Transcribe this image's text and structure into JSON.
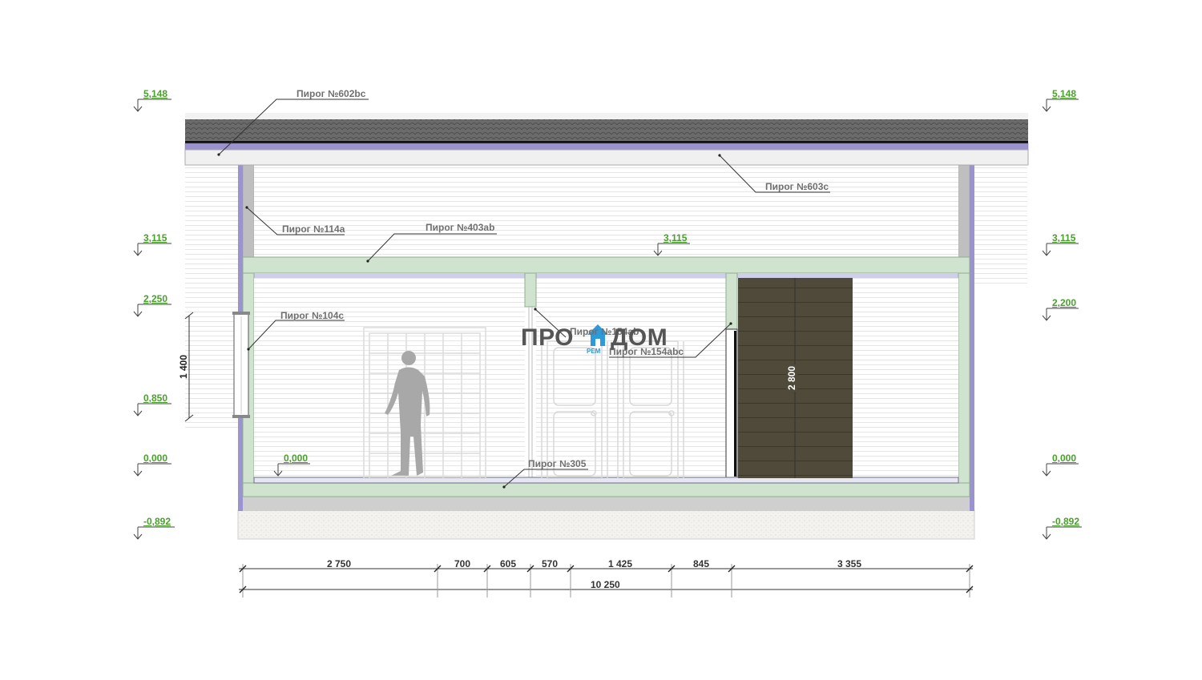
{
  "levels": {
    "left": [
      "5,148",
      "3,115",
      "2,250",
      "0,850",
      "0,000",
      "-0,892"
    ],
    "right": [
      "5,148",
      "3,115",
      "2,200",
      "0,000",
      "-0,892"
    ],
    "inner_ceiling": "3,115",
    "inner_floor": "0,000"
  },
  "labels": {
    "pirog_602bc": "Пирог №602bc",
    "pirog_603c": "Пирог №603c",
    "pirog_114a": "Пирог №114a",
    "pirog_403ab": "Пирог №403ab",
    "pirog_104c": "Пирог №104c",
    "pirog_154ab": "Пирог №154ab",
    "pirog_154abc": "Пирог №154abc",
    "pirog_305": "Пирог №305"
  },
  "dimensions": {
    "segments": [
      "2 750",
      "700",
      "605",
      "570",
      "1 425",
      "845",
      "3 355"
    ],
    "total": "10 250",
    "window_height": "1 400",
    "door_height": "2 800"
  },
  "logo": {
    "text_left": "ПРО",
    "text_right": "ДОМ",
    "sub": "РЕМ",
    "house_color": "#2e9ad8"
  },
  "colors": {
    "level_green": "#4aa02c",
    "frame_green": "#cfe3cf",
    "insulation_purple": "#9b93cf",
    "roof_dark": "#5e5e5e",
    "door_dark": "#4f4a3a"
  }
}
